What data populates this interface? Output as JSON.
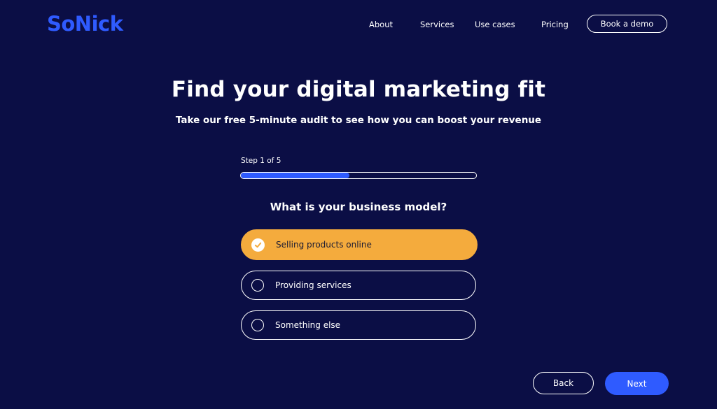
{
  "header": {
    "logo": "SoNick",
    "nav": [
      "About",
      "Services",
      "Use cases",
      "Pricing"
    ],
    "cta": "Book a demo"
  },
  "hero": {
    "title": "Find your digital marketing fit",
    "subtitle": "Take our free 5-minute audit to see how you can boost your revenue"
  },
  "quiz": {
    "step_label": "Step 1 of 5",
    "progress": 0.46,
    "question": "What is your business model?",
    "options": [
      {
        "label": "Selling products online",
        "selected": true
      },
      {
        "label": "Providing services",
        "selected": false
      },
      {
        "label": "Something else",
        "selected": false
      }
    ]
  },
  "footer": {
    "back": "Back",
    "next": "Next"
  },
  "colors": {
    "background": "#0b0e45",
    "accent_blue": "#2f5bff",
    "selected_option": "#f4ab3d"
  }
}
